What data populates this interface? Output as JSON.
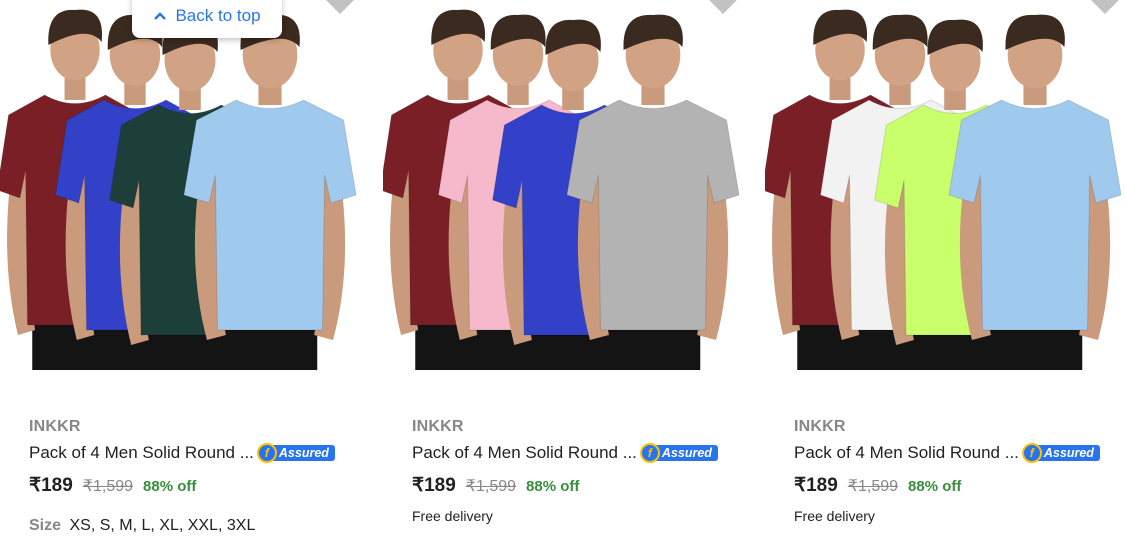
{
  "back_to_top": {
    "label": "Back to top",
    "icon": "chevron-up-icon"
  },
  "products": [
    {
      "brand": "INKKR",
      "title": "Pack of 4 Men Solid Round ...",
      "assured": "Assured",
      "price": "₹189",
      "mrp": "₹1,599",
      "discount": "88% off",
      "size_label": "Size",
      "sizes": "XS, S, M, L, XL, XXL, 3XL",
      "shirt_colors": [
        "#7a1f26",
        "#3340c8",
        "#1d3f3a",
        "#9fcaee"
      ]
    },
    {
      "brand": "INKKR",
      "title": "Pack of 4 Men Solid Round ...",
      "assured": "Assured",
      "price": "₹189",
      "mrp": "₹1,599",
      "discount": "88% off",
      "delivery": "Free delivery",
      "shirt_colors": [
        "#7a1f26",
        "#f6b9cb",
        "#3340c8",
        "#b3b3b3"
      ]
    },
    {
      "brand": "INKKR",
      "title": "Pack of 4 Men Solid Round ...",
      "assured": "Assured",
      "price": "₹189",
      "mrp": "₹1,599",
      "discount": "88% off",
      "delivery": "Free delivery",
      "shirt_colors": [
        "#7a1f26",
        "#f2f2f2",
        "#c8ff6b",
        "#9fcaee"
      ]
    }
  ],
  "colors": {
    "accent": "#2874f0",
    "discount": "#388e3c",
    "muted": "#878787",
    "assured_gold": "#ffc200"
  }
}
